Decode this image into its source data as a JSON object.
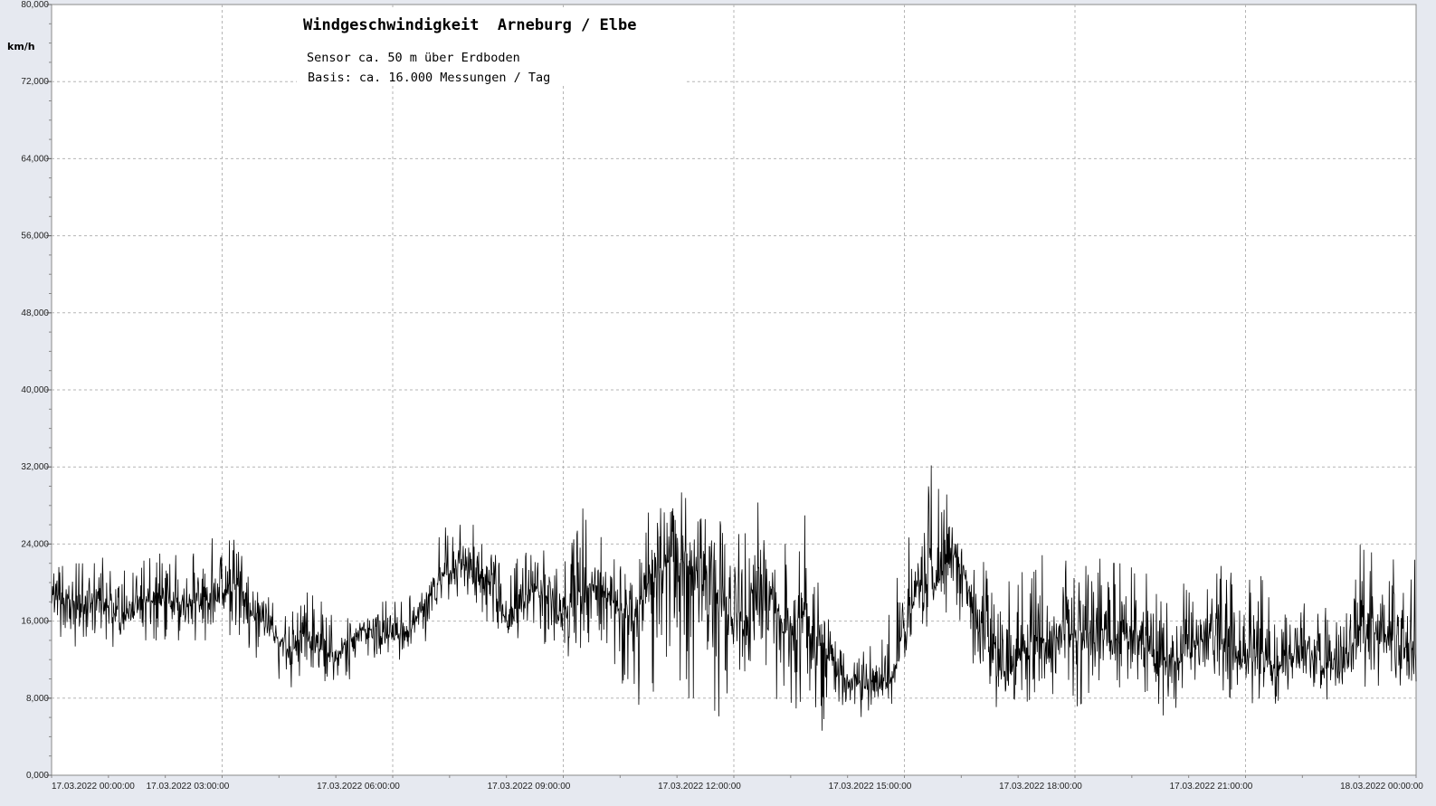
{
  "chart_data": {
    "type": "line",
    "title": "Windgeschwindigkeit  Arneburg / Elbe",
    "subtitle_lines": [
      "Sensor ca. 50 m über Erdboden",
      "Basis: ca. 16.000 Messungen / Tag"
    ],
    "ylabel": "km/h",
    "xlabel": "",
    "ylim": [
      0,
      80
    ],
    "xlim_hours": [
      0,
      24
    ],
    "grid": true,
    "legend": "none",
    "y_ticks": [
      "0,000",
      "8,000",
      "16,000",
      "24,000",
      "32,000",
      "40,000",
      "48,000",
      "56,000",
      "64,000",
      "72,000",
      "80,000"
    ],
    "x_ticks": [
      {
        "label": "17.03.2022  00:00:00",
        "hour": 0
      },
      {
        "label": "17.03.2022  03:00:00",
        "hour": 3
      },
      {
        "label": "17.03.2022  06:00:00",
        "hour": 6
      },
      {
        "label": "17.03.2022  09:00:00",
        "hour": 9
      },
      {
        "label": "17.03.2022  12:00:00",
        "hour": 12
      },
      {
        "label": "17.03.2022  15:00:00",
        "hour": 15
      },
      {
        "label": "17.03.2022  18:00:00",
        "hour": 18
      },
      {
        "label": "17.03.2022  21:00:00",
        "hour": 21
      },
      {
        "label": "18.03.2022  00:00:00",
        "hour": 24
      }
    ],
    "series": [
      {
        "color": "#000000",
        "x_hours": [
          0,
          0.25,
          0.5,
          0.75,
          1,
          1.25,
          1.5,
          1.75,
          2,
          2.25,
          2.5,
          2.75,
          3,
          3.25,
          3.5,
          3.75,
          4,
          4.25,
          4.5,
          4.75,
          5,
          5.25,
          5.5,
          5.75,
          6,
          6.25,
          6.5,
          6.75,
          7,
          7.25,
          7.5,
          7.75,
          8,
          8.25,
          8.5,
          8.75,
          9,
          9.25,
          9.5,
          9.75,
          10,
          10.25,
          10.5,
          10.75,
          11,
          11.25,
          11.5,
          11.75,
          12,
          12.25,
          12.5,
          12.75,
          13,
          13.25,
          13.5,
          13.75,
          14,
          14.25,
          14.5,
          14.75,
          15,
          15.25,
          15.5,
          15.75,
          16,
          16.25,
          16.5,
          16.75,
          17,
          17.25,
          17.5,
          17.75,
          18,
          18.25,
          18.5,
          18.75,
          19,
          19.25,
          19.5,
          19.75,
          20,
          20.25,
          20.5,
          20.75,
          21,
          21.25,
          21.5,
          21.75,
          22,
          22.25,
          22.5,
          22.75,
          23,
          23.25,
          23.5,
          23.75,
          24
        ],
        "mean_kmh": [
          19,
          18,
          17,
          18,
          18,
          17,
          18,
          18,
          18,
          18,
          18,
          18,
          19,
          20,
          17,
          16,
          14,
          13,
          15,
          13,
          12,
          14,
          15,
          15,
          14,
          15,
          17,
          20,
          21,
          22,
          21,
          20,
          16,
          18,
          19,
          18,
          17,
          19,
          20,
          19,
          17,
          16,
          20,
          22,
          23,
          21,
          22,
          18,
          16,
          18,
          20,
          17,
          14,
          17,
          14,
          11,
          10,
          9,
          9,
          10,
          14,
          20,
          19,
          22,
          23,
          16,
          13,
          11,
          12,
          14,
          14,
          15,
          15,
          15,
          15,
          14,
          15,
          13,
          12,
          12,
          13,
          14,
          15,
          13,
          12,
          13,
          11,
          12,
          13,
          12,
          11,
          12,
          15,
          15,
          14,
          13,
          14
        ],
        "max_kmh": [
          24,
          22,
          22,
          22,
          23,
          21,
          23,
          23,
          23,
          24,
          23,
          24,
          26,
          27,
          21,
          19,
          17,
          17,
          19,
          18,
          16,
          17,
          18,
          18,
          18,
          18,
          21,
          25,
          26,
          26,
          26,
          24,
          20,
          25,
          23,
          24,
          22,
          30,
          28,
          23,
          22,
          24,
          31,
          31,
          30,
          28,
          29,
          27,
          25,
          29,
          28,
          24,
          24,
          27,
          20,
          17,
          14,
          14,
          13,
          17,
          25,
          24,
          35,
          29,
          24,
          21,
          23,
          22,
          21,
          29,
          21,
          23,
          21,
          24,
          22,
          22,
          22,
          21,
          18,
          19,
          22,
          23,
          22,
          21,
          20,
          21,
          17,
          18,
          19,
          18,
          17,
          18,
          24,
          23,
          23,
          21,
          24
        ],
        "min_kmh": [
          15,
          14,
          12,
          13,
          13,
          14,
          14,
          14,
          14,
          14,
          14,
          14,
          14,
          15,
          13,
          11,
          10,
          9,
          11,
          10,
          9,
          10,
          12,
          12,
          11,
          12,
          13,
          16,
          17,
          18,
          16,
          16,
          13,
          14,
          15,
          13,
          12,
          13,
          14,
          14,
          10,
          7,
          8,
          10,
          8,
          8,
          8,
          6,
          7,
          6,
          8,
          6,
          4,
          5,
          4,
          7,
          7,
          6,
          7,
          7,
          11,
          16,
          15,
          17,
          16,
          10,
          8,
          6,
          7,
          8,
          8,
          9,
          7,
          8,
          9,
          8,
          7,
          7,
          6,
          7,
          7,
          8,
          9,
          8,
          7,
          8,
          6,
          7,
          7,
          7,
          7,
          8,
          9,
          8,
          8,
          7,
          8
        ]
      }
    ]
  }
}
